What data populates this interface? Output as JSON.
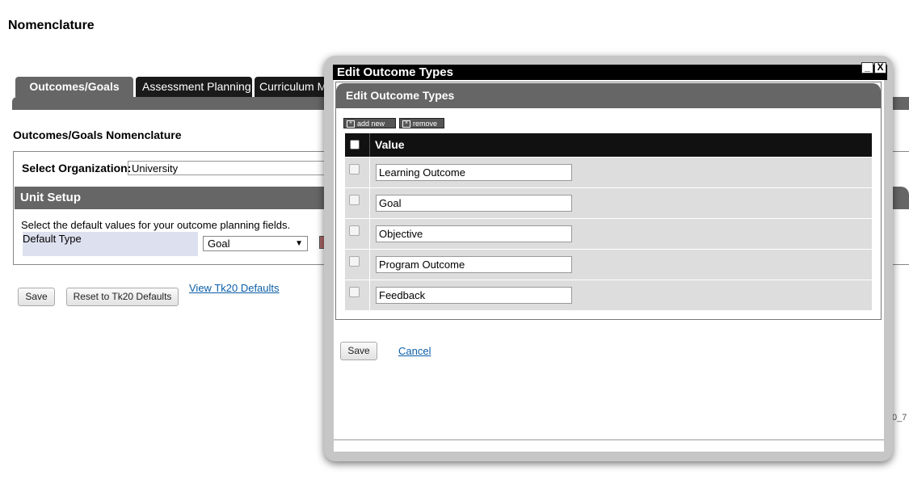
{
  "page": {
    "title": "Nomenclature",
    "tabs": [
      "Outcomes/Goals",
      "Assessment Planning",
      "Curriculum Ma"
    ],
    "section_title": "Outcomes/Goals Nomenclature",
    "select_org_label": "Select Organization:",
    "org_value": "University",
    "unit_setup_title": "Unit Setup",
    "unit_description": "Select the default values for your outcome planning fields.",
    "default_type_label": "Default Type",
    "default_type_value": "Goal",
    "save_label": "Save",
    "reset_label": "Reset to Tk20 Defaults",
    "view_defaults_link": "View Tk20 Defaults",
    "footnote": "0_7"
  },
  "modal": {
    "window_title": "Edit Outcome Types",
    "header": "Edit Outcome Types",
    "minimize_glyph": "_",
    "close_glyph": "X",
    "add_new_label": "add new",
    "remove_label": "remove",
    "column_value": "Value",
    "rows": [
      "Learning Outcome",
      "Goal",
      "Objective",
      "Program Outcome",
      "Feedback"
    ],
    "save_label": "Save",
    "cancel_label": "Cancel"
  },
  "colors": {
    "tab_dark": "#1a1a1a",
    "tab_active": "#666666",
    "link": "#0b5ea8",
    "row_bg": "#dddddd",
    "modal_frame": "#c6c6c6"
  }
}
